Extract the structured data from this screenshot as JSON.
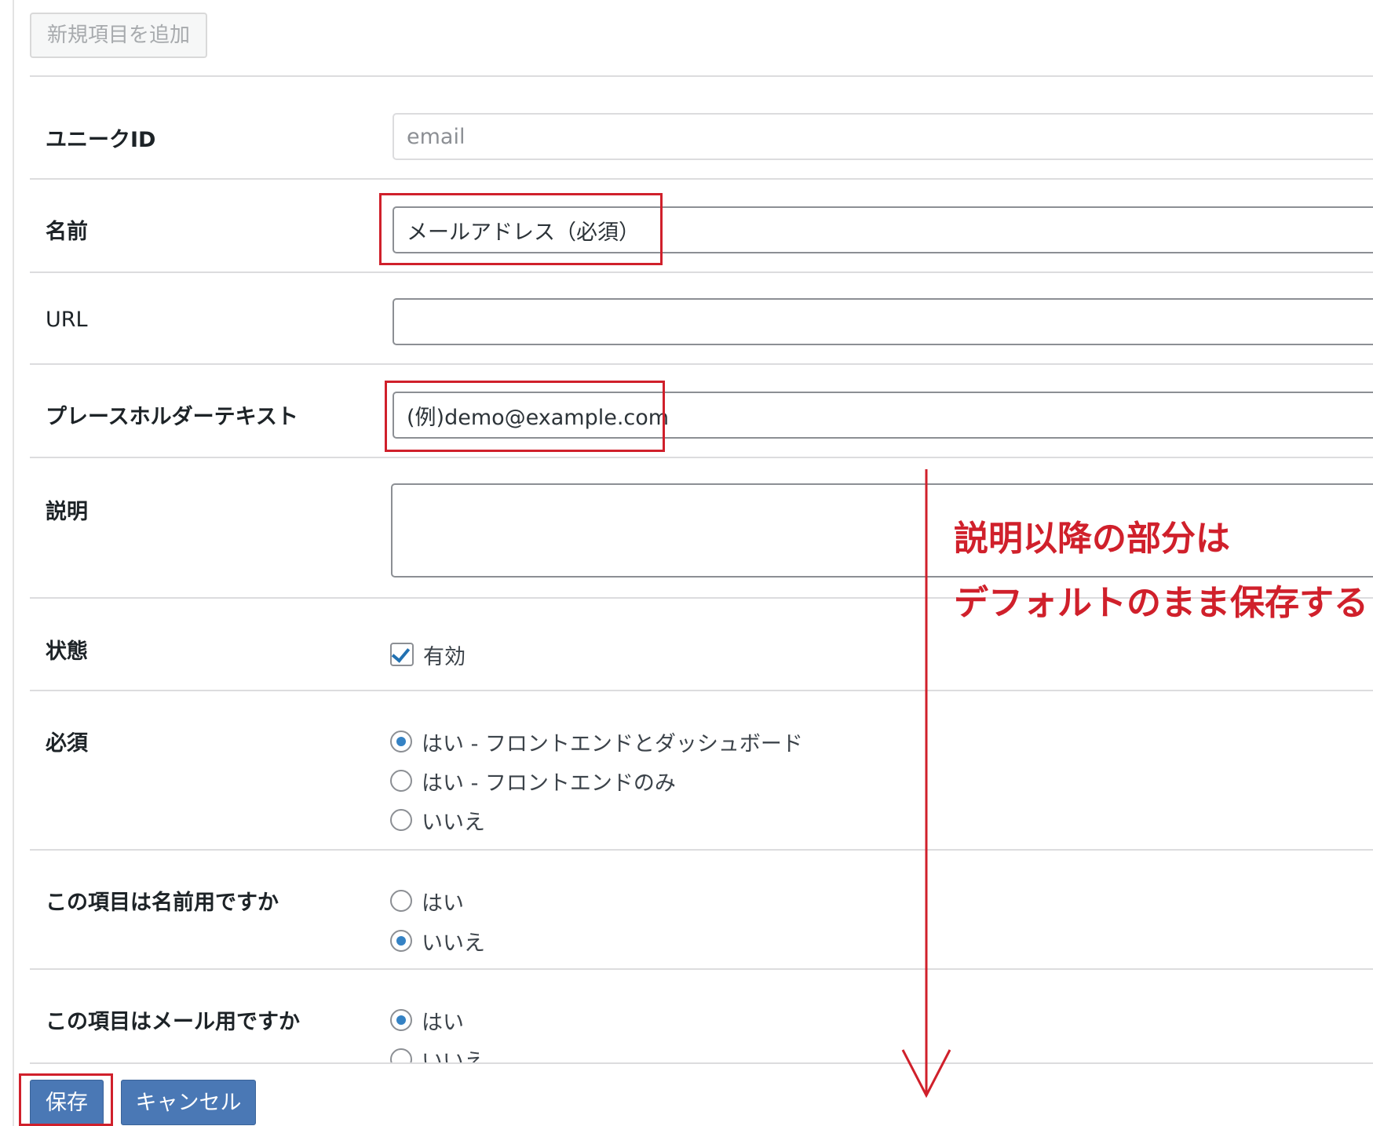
{
  "toolbar": {
    "add_new_label": "新規項目を追加"
  },
  "form": {
    "unique_id": {
      "label": "ユニークID",
      "value": "email"
    },
    "name": {
      "label": "名前",
      "value": "メールアドレス（必須）"
    },
    "url": {
      "label": "URL",
      "value": ""
    },
    "placeholder_text": {
      "label": "プレースホルダーテキスト",
      "value": "(例)demo@example.com"
    },
    "description": {
      "label": "説明",
      "value": ""
    },
    "status": {
      "label": "状態",
      "checkbox_label": "有効",
      "checked": true
    },
    "required": {
      "label": "必須",
      "options": [
        {
          "label": "はい - フロントエンドとダッシュボード",
          "selected": true
        },
        {
          "label": "はい - フロントエンドのみ",
          "selected": false
        },
        {
          "label": "いいえ",
          "selected": false
        }
      ]
    },
    "is_name_field": {
      "label": "この項目は名前用ですか",
      "options": [
        {
          "label": "はい",
          "selected": false
        },
        {
          "label": "いいえ",
          "selected": true
        }
      ]
    },
    "is_email_field": {
      "label": "この項目はメール用ですか",
      "options": [
        {
          "label": "はい",
          "selected": true
        },
        {
          "label": "いいえ",
          "selected": false
        }
      ]
    }
  },
  "actions": {
    "save_label": "保存",
    "cancel_label": "キャンセル"
  },
  "annotation": {
    "line1": "説明以降の部分は",
    "line2": "デフォルトのまま保存する",
    "color": "#d0202b"
  },
  "colors": {
    "accent": "#4a78b5",
    "radio_checked": "#3582c4",
    "highlight": "#d0202b"
  }
}
